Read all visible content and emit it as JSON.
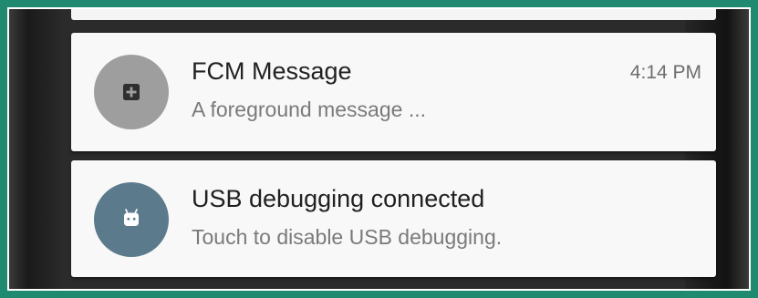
{
  "notifications": [
    {
      "title": "FCM Message",
      "text": "A foreground message ...",
      "time": "4:14 PM",
      "icon": "add-box-icon",
      "icon_bg": "#9e9e9e"
    },
    {
      "title": "USB debugging connected",
      "text": "Touch to disable USB debugging.",
      "icon": "android-icon",
      "icon_bg": "#5b7b8c"
    }
  ],
  "colors": {
    "frame_border": "#1f8a70",
    "card_background": "#f8f8f8",
    "shade_background": "#2b2b2b"
  }
}
